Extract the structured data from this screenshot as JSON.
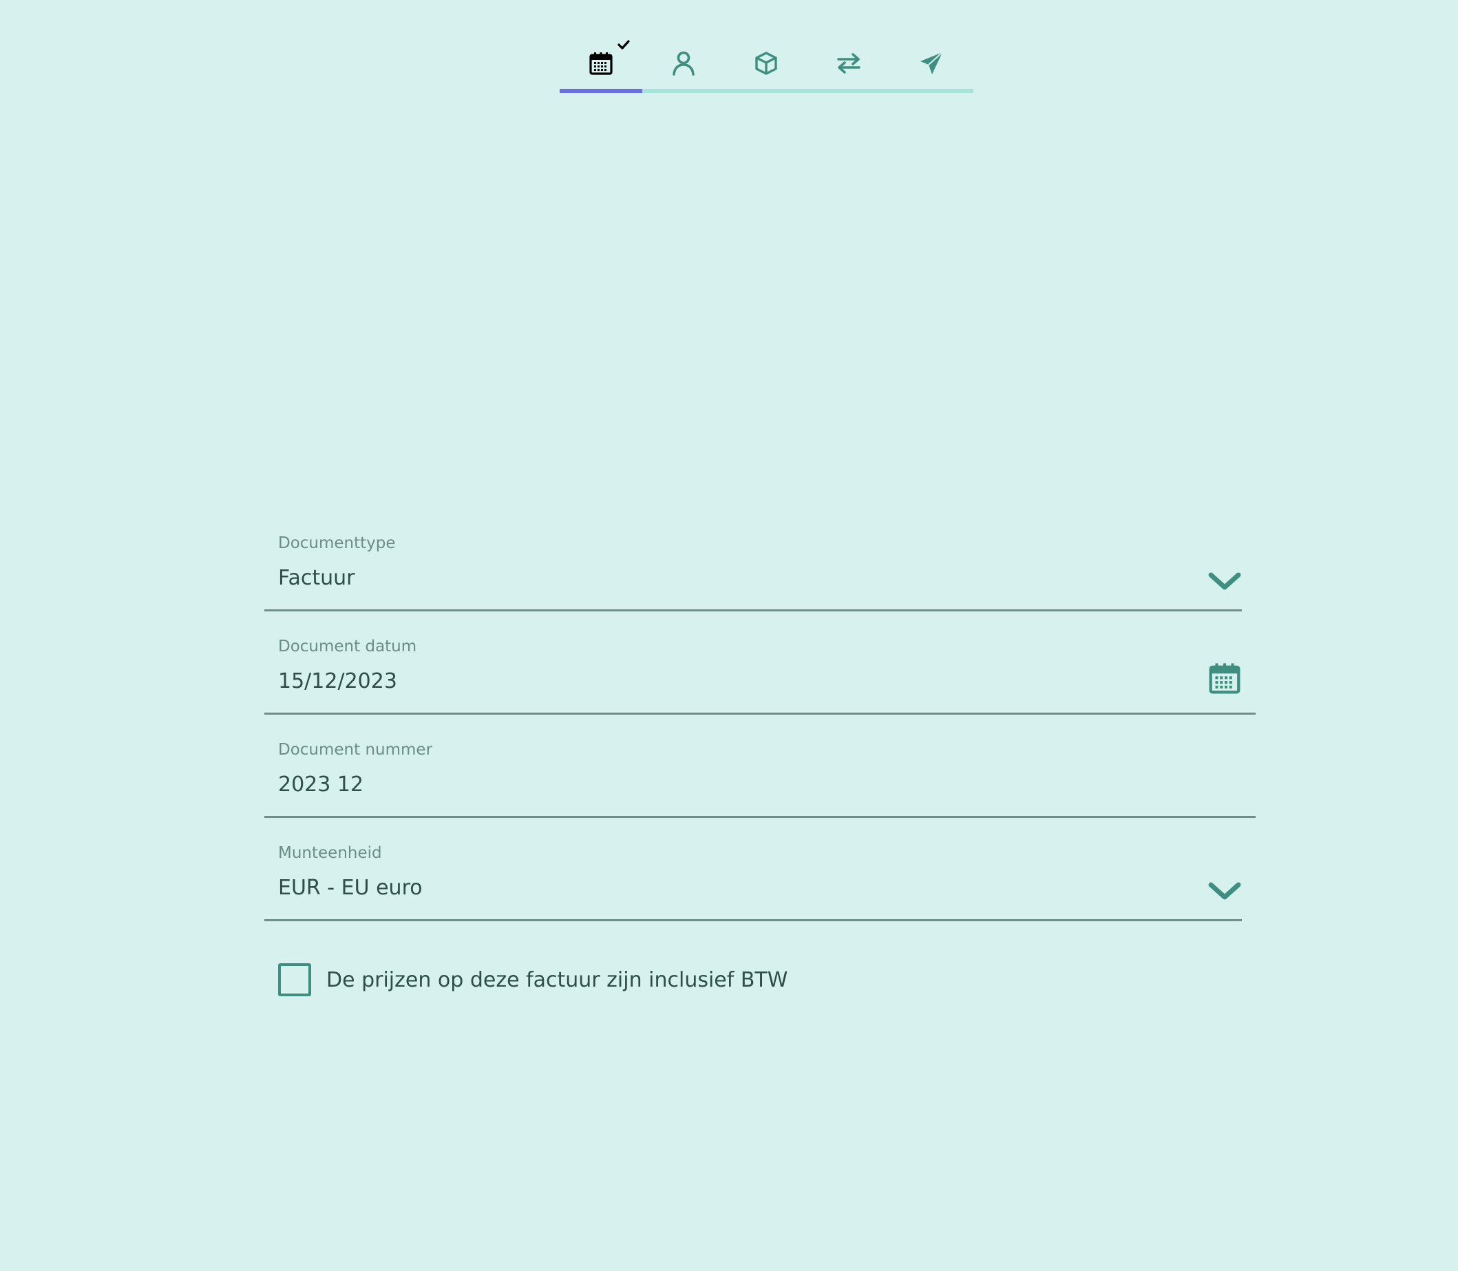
{
  "stepper": {
    "steps": [
      {
        "icon": "calendar-icon",
        "state": "active",
        "completed": true
      },
      {
        "icon": "person-icon",
        "state": "pending"
      },
      {
        "icon": "box-icon",
        "state": "pending"
      },
      {
        "icon": "transfer-arrows-icon",
        "state": "pending"
      },
      {
        "icon": "paper-plane-icon",
        "state": "pending"
      }
    ],
    "progress_fraction": 0.2,
    "colors": {
      "active": "#000000",
      "pending": "#3f8f80",
      "progress": "#6b70e0",
      "track": "#a9e3da"
    }
  },
  "form": {
    "document_type": {
      "label": "Documenttype",
      "value": "Factuur"
    },
    "document_date": {
      "label": "Document datum",
      "value": "15/12/2023"
    },
    "document_number": {
      "label": "Document nummer",
      "value": "2023 12"
    },
    "currency": {
      "label": "Munteenheid",
      "value": "EUR - EU euro"
    },
    "vat_inclusive": {
      "label": "De prijzen op deze factuur zijn inclusief BTW",
      "checked": false
    }
  },
  "theme": {
    "background": "#d7f2ee",
    "accent": "#3f8f80",
    "text": "#2f4e49",
    "label": "#6c8c86"
  }
}
